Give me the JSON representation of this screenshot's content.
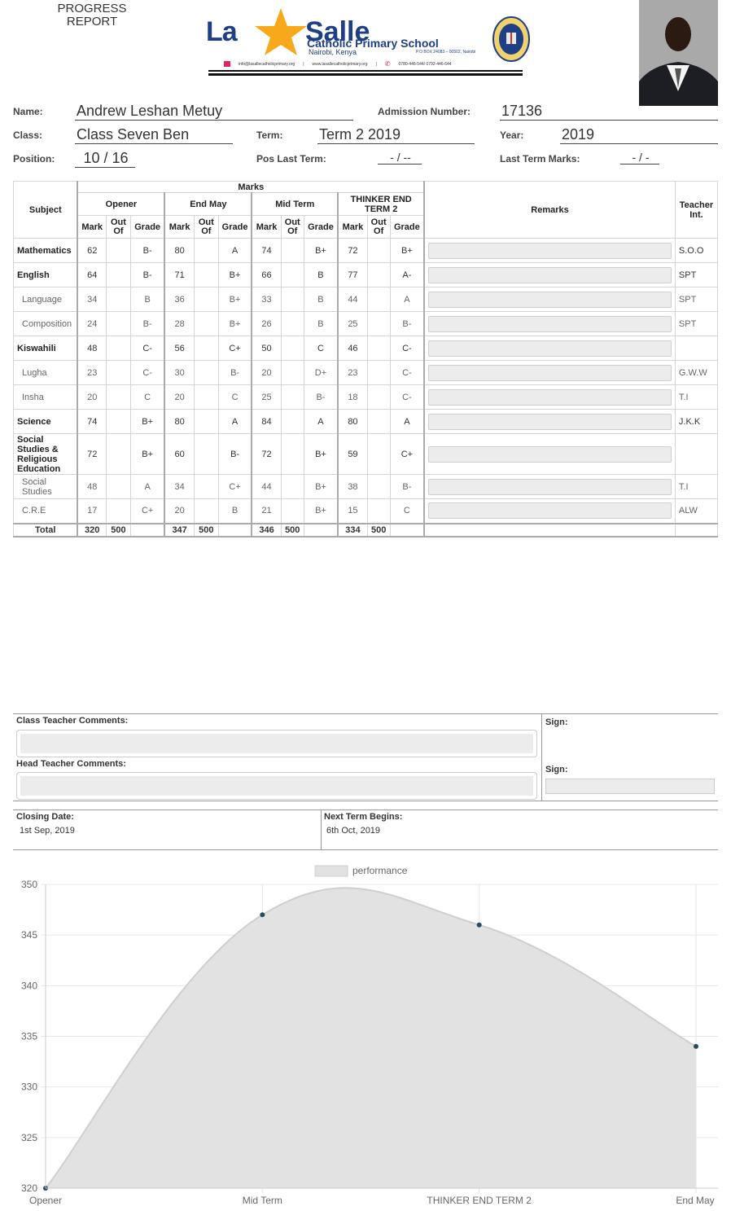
{
  "header": {
    "report_label": "PROGRESS REPORT",
    "school_name_1": "La",
    "school_name_2": "Salle",
    "school_subtitle": "Catholic Primary School",
    "school_location": "Nairobi, Kenya",
    "pobox": "P.O BOX 24083 – 00502, Nairobi",
    "email": "info@lasallecatholicprimary.org",
    "website": "www.lasallecatholicprimary.org",
    "phone": "0780-446-544/ 0792-446-644"
  },
  "student": {
    "name_label": "Name:",
    "name": "Andrew Leshan Metuy",
    "admission_label": "Admission Number:",
    "admission": "17136",
    "class_label": "Class:",
    "class": "Class Seven Ben",
    "term_label": "Term:",
    "term": "Term 2 2019",
    "year_label": "Year:",
    "year": "2019",
    "position_label": "Position:",
    "position": "10 / 16",
    "pos_last_label": "Pos Last Term:",
    "pos_last": "- / --",
    "last_marks_label": "Last Term Marks:",
    "last_marks": "- / -"
  },
  "table": {
    "subject_header": "Subject",
    "marks_header": "Marks",
    "remarks_header": "Remarks",
    "teacher_header_1": "Teacher",
    "teacher_header_2": "Int.",
    "exams": [
      "Opener",
      "End May",
      "Mid Term",
      "THINKER END TERM 2"
    ],
    "col_mark": "Mark",
    "col_outof": "Out Of",
    "col_grade": "Grade",
    "rows": [
      {
        "subject": "Mathematics",
        "sub": false,
        "cells": [
          "62",
          "",
          "B-",
          "80",
          "",
          "A",
          "74",
          "",
          "B+",
          "72",
          "",
          "B+"
        ],
        "teacher": "S.O.O"
      },
      {
        "subject": "English",
        "sub": false,
        "cells": [
          "64",
          "",
          "B-",
          "71",
          "",
          "B+",
          "66",
          "",
          "B",
          "77",
          "",
          "A-"
        ],
        "teacher": "SPT"
      },
      {
        "subject": "Language",
        "sub": true,
        "cells": [
          "34",
          "",
          "B",
          "36",
          "",
          "B+",
          "33",
          "",
          "B",
          "44",
          "",
          "A"
        ],
        "teacher": "SPT"
      },
      {
        "subject": "Composition",
        "sub": true,
        "cells": [
          "24",
          "",
          "B-",
          "28",
          "",
          "B+",
          "26",
          "",
          "B",
          "25",
          "",
          "B-"
        ],
        "teacher": "SPT"
      },
      {
        "subject": "Kiswahili",
        "sub": false,
        "cells": [
          "48",
          "",
          "C-",
          "56",
          "",
          "C+",
          "50",
          "",
          "C",
          "46",
          "",
          "C-"
        ],
        "teacher": ""
      },
      {
        "subject": "Lugha",
        "sub": true,
        "cells": [
          "23",
          "",
          "C-",
          "30",
          "",
          "B-",
          "20",
          "",
          "D+",
          "23",
          "",
          "C-"
        ],
        "teacher": "G.W.W"
      },
      {
        "subject": "Insha",
        "sub": true,
        "cells": [
          "20",
          "",
          "C",
          "20",
          "",
          "C",
          "25",
          "",
          "B-",
          "18",
          "",
          "C-"
        ],
        "teacher": "T.I"
      },
      {
        "subject": "Science",
        "sub": false,
        "cells": [
          "74",
          "",
          "B+",
          "80",
          "",
          "A",
          "84",
          "",
          "A",
          "80",
          "",
          "A"
        ],
        "teacher": "J.K.K"
      },
      {
        "subject": "Social Studies & Religious Education",
        "sub": false,
        "cells": [
          "72",
          "",
          "B+",
          "60",
          "",
          "B-",
          "72",
          "",
          "B+",
          "59",
          "",
          "C+"
        ],
        "teacher": ""
      },
      {
        "subject": "Social Studies",
        "sub": true,
        "cells": [
          "48",
          "",
          "A",
          "34",
          "",
          "C+",
          "44",
          "",
          "B+",
          "38",
          "",
          "B-"
        ],
        "teacher": "T.I"
      },
      {
        "subject": "C.R.E",
        "sub": true,
        "cells": [
          "17",
          "",
          "C+",
          "20",
          "",
          "B",
          "21",
          "",
          "B+",
          "15",
          "",
          "C"
        ],
        "teacher": "ALW"
      }
    ],
    "total_label": "Total",
    "totals": [
      "320",
      "500",
      "",
      "347",
      "500",
      "",
      "346",
      "500",
      "",
      "334",
      "500",
      ""
    ]
  },
  "comments": {
    "class_teacher_label": "Class Teacher Comments:",
    "head_teacher_label": "Head Teacher Comments:",
    "sign_label_1": "Sign:",
    "sign_label_2": "Sign:",
    "closing_label": "Closing Date:",
    "closing_date": "1st Sep, 2019",
    "next_term_label": "Next Term Begins:",
    "next_term_date": "6th Oct, 2019"
  },
  "chart_data": {
    "type": "area",
    "categories": [
      "Opener",
      "Mid Term",
      "THINKER END TERM 2",
      "End May"
    ],
    "series": [
      {
        "name": "performance",
        "values": [
          320,
          347,
          346,
          334
        ]
      }
    ],
    "ylim": [
      320,
      350
    ],
    "yticks": [
      320,
      325,
      330,
      335,
      340,
      345,
      350
    ],
    "grid": true,
    "legend": "top-center",
    "fill_color": "#e2e2e2",
    "line_color": "#cfcfcf",
    "point_color": "#2b4a5e"
  }
}
